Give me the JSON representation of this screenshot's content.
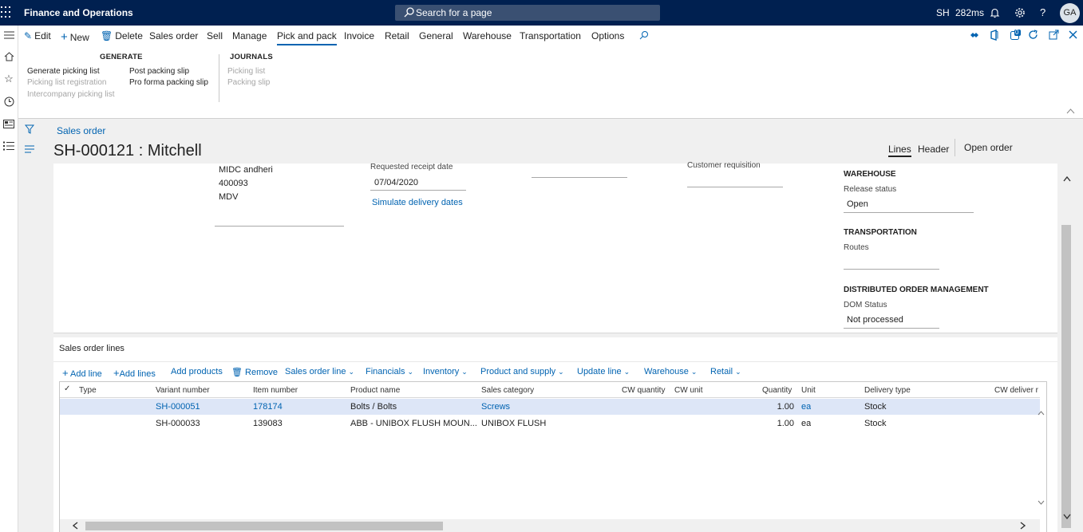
{
  "topbar": {
    "app_title": "Finance and Operations",
    "search_placeholder": "Search for a page",
    "company": "SH",
    "timing": "282ms",
    "avatar_initials": "GA"
  },
  "actionpane": {
    "tabs": [
      "Edit",
      "New",
      "Delete",
      "Sales order",
      "Sell",
      "Manage",
      "Pick and pack",
      "Invoice",
      "Retail",
      "General",
      "Warehouse",
      "Transportation",
      "Options"
    ],
    "active_tab": "Pick and pack",
    "groups": {
      "generate": {
        "title": "GENERATE",
        "items": [
          "Generate picking list",
          "Picking list registration",
          "Intercompany picking list",
          "Post packing slip",
          "Pro forma packing slip"
        ]
      },
      "journals": {
        "title": "JOURNALS",
        "items": [
          "Picking list",
          "Packing slip"
        ]
      }
    },
    "badge_count": "0"
  },
  "page": {
    "breadcrumb": "Sales order",
    "title": "SH-000121 : Mitchell",
    "view_tabs": [
      "Lines",
      "Header"
    ],
    "open_order": "Open order"
  },
  "header_card": {
    "address_lines": [
      "MIDC andheri",
      "400093",
      "MDV"
    ],
    "requested_receipt_date_label": "Requested receipt date",
    "requested_receipt_date": "07/04/2020",
    "simulate_link": "Simulate delivery dates",
    "customer_requisition_label": "Customer requisition",
    "warehouse_section": "WAREHOUSE",
    "release_status_label": "Release status",
    "release_status": "Open",
    "transportation_section": "TRANSPORTATION",
    "routes_label": "Routes",
    "dom_section": "DISTRIBUTED ORDER MANAGEMENT",
    "dom_status_label": "DOM Status",
    "dom_status": "Not processed"
  },
  "lines": {
    "title": "Sales order lines",
    "toolbar": [
      "Add line",
      "Add lines",
      "Add products",
      "Remove",
      "Sales order line",
      "Financials",
      "Inventory",
      "Product and supply",
      "Update line",
      "Warehouse",
      "Retail"
    ],
    "columns": [
      "Type",
      "Variant number",
      "Item number",
      "Product name",
      "Sales category",
      "CW quantity",
      "CW unit",
      "Quantity",
      "Unit",
      "Delivery type",
      "CW deliver r"
    ],
    "rows": [
      {
        "type": "",
        "variant": "SH-000051",
        "item": "178174",
        "product": "Bolts / Bolts",
        "category": "Screws",
        "cw_qty": "",
        "cw_unit": "",
        "qty": "1.00",
        "unit": "ea",
        "delivery": "Stock"
      },
      {
        "type": "",
        "variant": "SH-000033",
        "item": "139083",
        "product": "ABB - UNIBOX FLUSH MOUN...",
        "category": "UNIBOX FLUSH",
        "cw_qty": "",
        "cw_unit": "",
        "qty": "1.00",
        "unit": "ea",
        "delivery": "Stock"
      }
    ]
  },
  "colors": {
    "nav_bg": "#002050",
    "accent": "#0063b1",
    "selected_row": "#dde6f7"
  }
}
